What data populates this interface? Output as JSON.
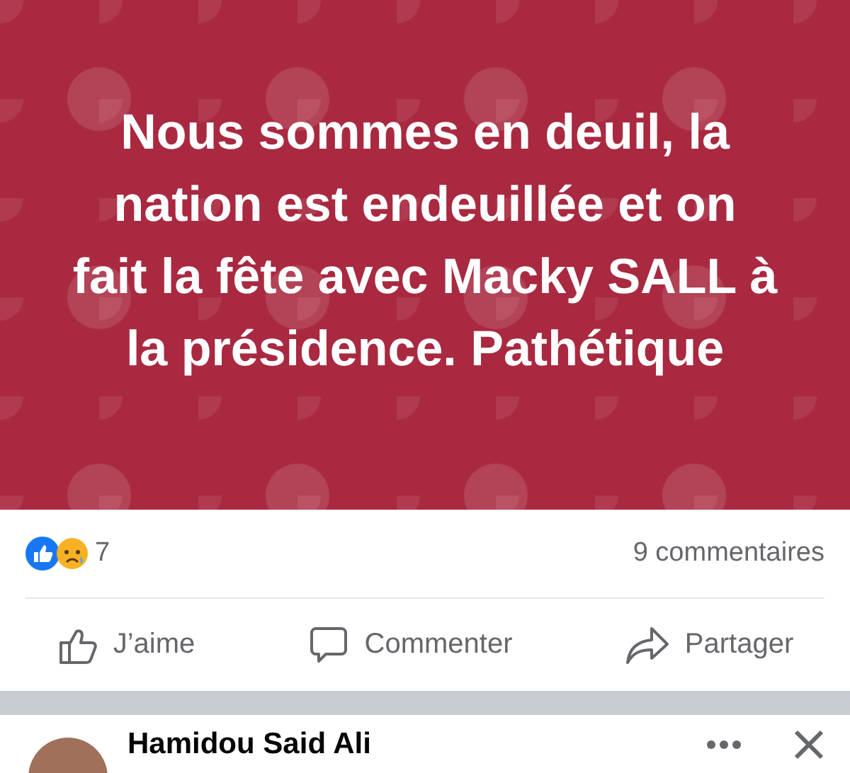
{
  "post": {
    "text": "Nous sommes en deuil, la nation est endeuillée et on fait la fête avec Macky SALL à la présidence. Pathétique"
  },
  "reactions": {
    "count": "7",
    "comments": "9 commentaires"
  },
  "actions": [
    {
      "kind": "like",
      "label": "J’aime"
    },
    {
      "kind": "comment",
      "label": "Commenter"
    },
    {
      "kind": "share",
      "label": "Partager"
    }
  ],
  "next_post": {
    "author": "Hamidou Said Ali"
  }
}
